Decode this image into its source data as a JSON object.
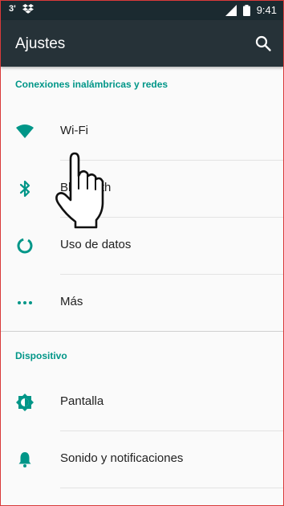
{
  "status_bar": {
    "left_indicator": "3'",
    "time": "9:41",
    "icons": [
      "dropbox-icon",
      "signal-icon",
      "battery-icon"
    ]
  },
  "app_bar": {
    "title": "Ajustes",
    "search_icon": "search-icon"
  },
  "sections": [
    {
      "header": "Conexiones inalámbricas y redes",
      "items": [
        {
          "icon": "wifi-icon",
          "label": "Wi-Fi"
        },
        {
          "icon": "bluetooth-icon",
          "label": "Bluetooth"
        },
        {
          "icon": "data-usage-icon",
          "label": "Uso de datos"
        },
        {
          "icon": "more-icon",
          "label": "Más"
        }
      ]
    },
    {
      "header": "Dispositivo",
      "items": [
        {
          "icon": "display-icon",
          "label": "Pantalla"
        },
        {
          "icon": "bell-icon",
          "label": "Sonido y notificaciones"
        }
      ]
    }
  ],
  "colors": {
    "accent": "#009688",
    "app_bar": "#263238",
    "status_bar": "#1b2a30"
  }
}
